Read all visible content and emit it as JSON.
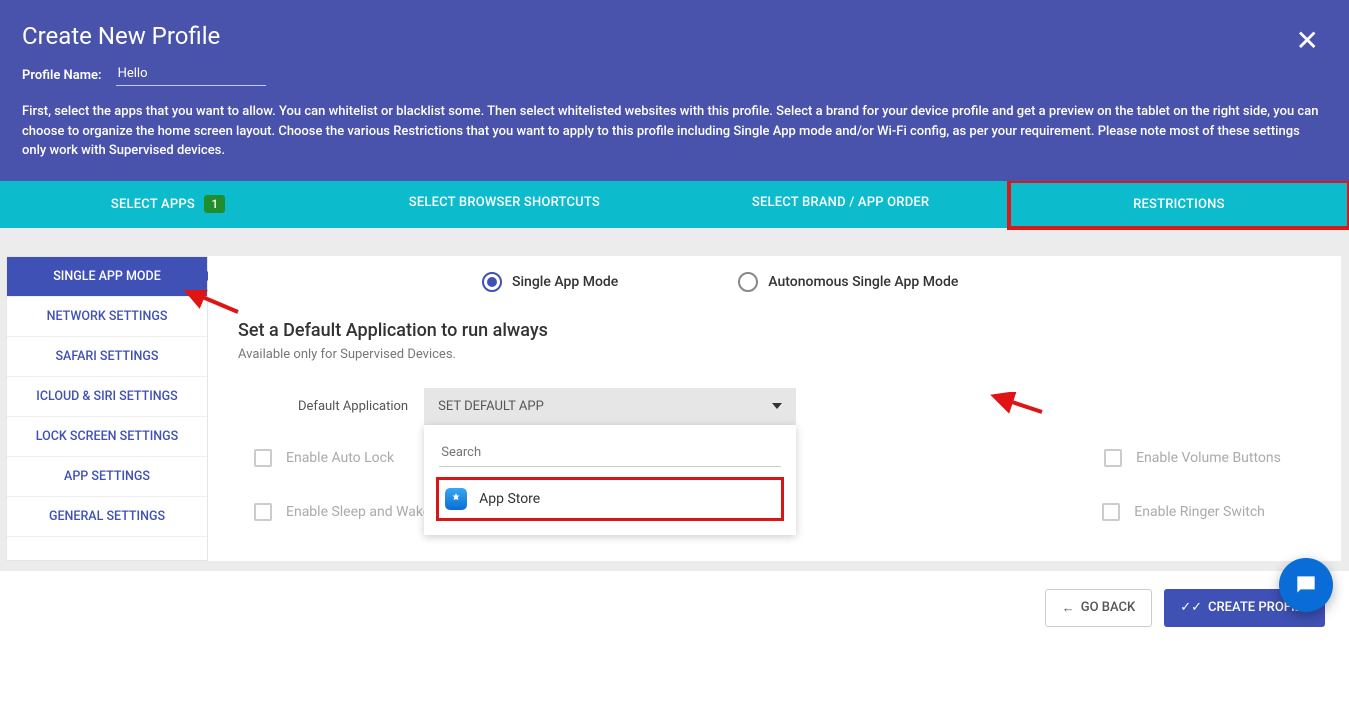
{
  "header": {
    "title": "Create New Profile",
    "profileNameLabel": "Profile Name:",
    "profileNameValue": "Hello",
    "description": "First, select the apps that you want to allow. You can whitelist or blacklist some. Then select whitelisted websites with this profile. Select a brand for your device profile and get a preview on the tablet on the right side, you can choose to organize the home screen layout. Choose the various Restrictions that you want to apply to this profile including Single App mode and/or Wi-Fi config, as per your requirement. Please note most of these settings only work with Supervised devices."
  },
  "tabs": {
    "items": [
      {
        "label": "SELECT APPS",
        "badge": "1"
      },
      {
        "label": "SELECT BROWSER SHORTCUTS"
      },
      {
        "label": "SELECT BRAND / APP ORDER"
      },
      {
        "label": "RESTRICTIONS"
      }
    ]
  },
  "sidebar": {
    "items": [
      "SINGLE APP MODE",
      "NETWORK SETTINGS",
      "SAFARI SETTINGS",
      "ICLOUD & SIRI SETTINGS",
      "LOCK SCREEN SETTINGS",
      "APP SETTINGS",
      "GENERAL SETTINGS"
    ]
  },
  "radios": {
    "opt1": "Single App Mode",
    "opt2": "Autonomous Single App Mode"
  },
  "section": {
    "title": "Set a Default Application to run always",
    "subtitle": "Available only for Supervised Devices."
  },
  "defaultApp": {
    "label": "Default Application",
    "placeholder": "SET DEFAULT APP",
    "searchPlaceholder": "Search",
    "option1": "App Store"
  },
  "checks": {
    "c1": "Enable Auto Lock",
    "c2": "Enable Volume Buttons",
    "c3": "Enable Sleep and Wake",
    "c4": "Enable Ringer Switch"
  },
  "footer": {
    "back": "GO BACK",
    "create": "CREATE PROFILE"
  }
}
